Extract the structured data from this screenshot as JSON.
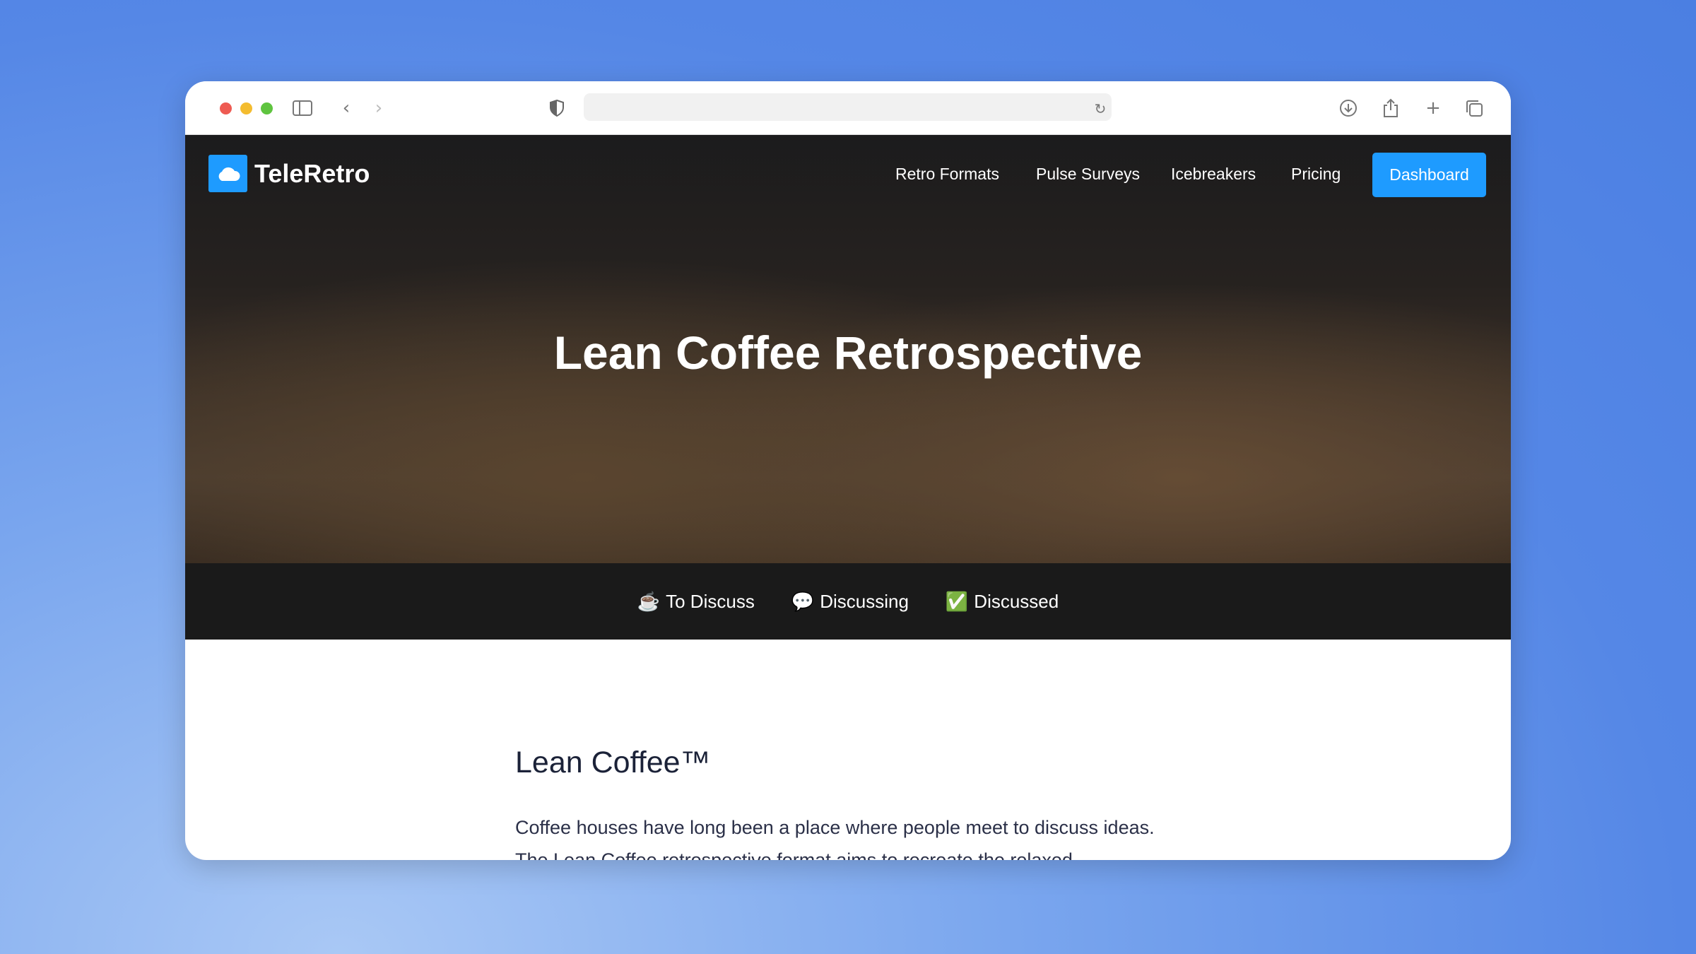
{
  "browser": {
    "icons": [
      "sidebar-icon",
      "back-icon",
      "forward-icon",
      "shield-icon",
      "reload-icon",
      "download-icon",
      "share-icon",
      "new-tab-icon",
      "tabs-icon"
    ],
    "url": ""
  },
  "site": {
    "brand": "TeleRetro",
    "brand_color": "#1e9bff",
    "nav": [
      {
        "label": "Retro Formats"
      },
      {
        "label": "Pulse Surveys"
      },
      {
        "label": "Icebreakers"
      },
      {
        "label": "Pricing"
      }
    ],
    "cta": "Dashboard"
  },
  "hero": {
    "title": "Lean Coffee Retrospective"
  },
  "columns": [
    {
      "icon": "☕",
      "label": "To Discuss"
    },
    {
      "icon": "💬",
      "label": "Discussing"
    },
    {
      "icon": "✅",
      "label": "Discussed"
    }
  ],
  "content": {
    "heading": "Lean Coffee™",
    "paragraph": "Coffee houses have long been a place where people meet to discuss ideas. The Lean Coffee retrospective format aims to recreate the relaxed"
  }
}
